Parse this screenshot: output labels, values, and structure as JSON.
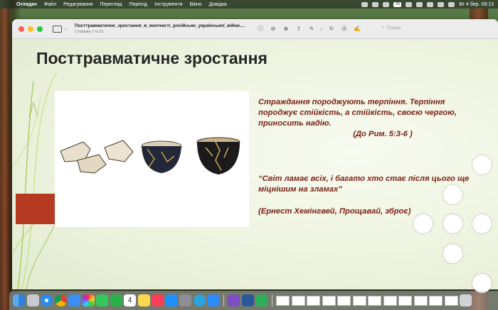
{
  "menubar": {
    "items": [
      "Оглядач",
      "Файл",
      "Редагування",
      "Перегляд",
      "Перехід",
      "Інструменти",
      "Вікно",
      "Довідка"
    ],
    "keyboard_layout": "УК",
    "clock": "Вт 4 бер.  09:13"
  },
  "window": {
    "document_name": "Посттравматичне_зростання_в_контексті_російсько_української_війни....",
    "page_indicator": "Сторінка 7 із 23",
    "search_placeholder": "Пошук",
    "tools": [
      "info-icon",
      "zoom-out-icon",
      "zoom-in-icon",
      "share-icon",
      "markup-pen-icon",
      "chevron-down-icon",
      "rotate-icon",
      "highlight-icon",
      "annotate-icon"
    ]
  },
  "slide": {
    "title": "Посттравматичне зростання",
    "quote1": "Страждання породжують терпіння. Терпіння породжує стійкість, а стійкість, своєю чергою, приносить надію.",
    "quote1_ref": "(До Рим. 5:3-6 )",
    "quote2": "“Світ ламає всіх, і багато хто стає після цього ще міцнішим на зламах”",
    "quote3": "(Ернест Хемінгвей, Прощавай, зброє)"
  },
  "colors": {
    "accent_red": "#b63a22",
    "quote_text": "#7a1f12",
    "title_text": "#262626"
  },
  "dock": {
    "apps": [
      "finder",
      "launchpad",
      "safari",
      "chrome",
      "mail",
      "photos",
      "messages",
      "facetime",
      "calendar",
      "notes",
      "music",
      "app-store",
      "system-settings",
      "telegram",
      "zoom",
      "viber",
      "word",
      "numbers",
      "trash"
    ],
    "calendar_day": "4"
  }
}
